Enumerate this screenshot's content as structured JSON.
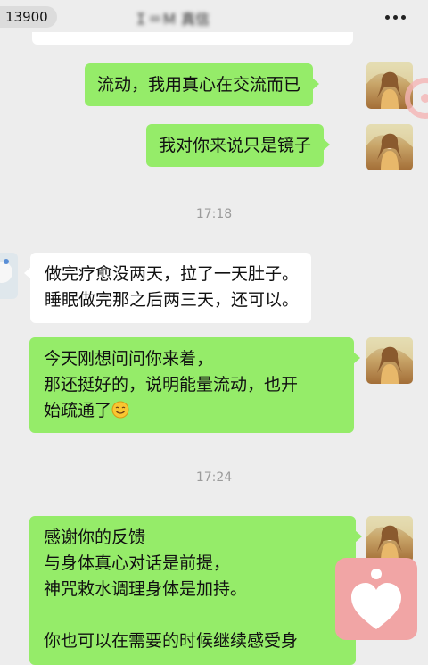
{
  "header": {
    "back_count": "13900",
    "title": "Ｉ＝Ｍ 真信"
  },
  "messages": [
    {
      "from": "me",
      "lines": [
        "流动，我用真心在交流而已"
      ]
    },
    {
      "from": "me",
      "lines": [
        "我对你来说只是镜子"
      ]
    },
    {
      "type": "time",
      "text": "17:18"
    },
    {
      "from": "other",
      "lines": [
        "做完疗愈没两天，拉了一天肚子。",
        "睡眠做完那之后两三天，还可以。"
      ]
    },
    {
      "from": "me",
      "lines": [
        "今天刚想问问你来着，",
        "那还挺好的，说明能量流动，也开",
        "始疏通了"
      ],
      "emoji": "smiling-emoji"
    },
    {
      "type": "time",
      "text": "17:24"
    },
    {
      "from": "me",
      "lines": [
        "感谢你的反馈",
        "与身体真心对话是前提，",
        "神咒敕水调理身体是加持。",
        "",
        "你也可以在需要的时候继续感受身"
      ]
    }
  ],
  "colors": {
    "background": "#ededed",
    "bubble_me": "#95ec69",
    "bubble_other": "#ffffff",
    "timestamp": "#9b9b9b",
    "favorite_badge": "#f1a5a5"
  },
  "icons": {
    "more": "more-icon",
    "favorite": "heart-badge-icon",
    "avatar_me": "user-avatar-icon",
    "avatar_other": "contact-avatar-icon"
  }
}
